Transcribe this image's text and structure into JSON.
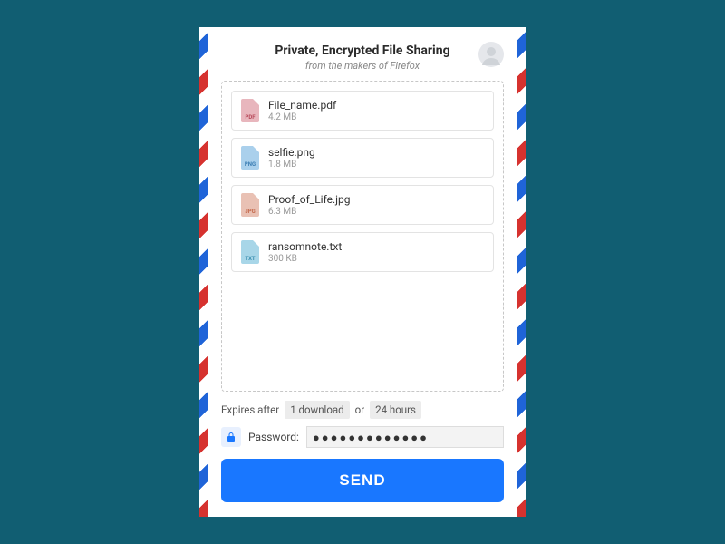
{
  "header": {
    "title": "Private, Encrypted File Sharing",
    "subtitle": "from the makers of Firefox"
  },
  "files": [
    {
      "name": "File_name.pdf",
      "size": "4.2 MB",
      "ext": "PDF",
      "icon_class": "ic-pdf"
    },
    {
      "name": "selfie.png",
      "size": "1.8 MB",
      "ext": "PNG",
      "icon_class": "ic-png"
    },
    {
      "name": "Proof_of_Life.jpg",
      "size": "6.3 MB",
      "ext": "JPG",
      "icon_class": "ic-jpg"
    },
    {
      "name": "ransomnote.txt",
      "size": "300 KB",
      "ext": "TXT",
      "icon_class": "ic-txt"
    }
  ],
  "options": {
    "prefix": "Expires after",
    "downloads": "1 download",
    "separator": "or",
    "duration": "24 hours"
  },
  "password": {
    "label": "Password:",
    "value": "●●●●●●●●●●●●●"
  },
  "actions": {
    "send": "SEND"
  }
}
